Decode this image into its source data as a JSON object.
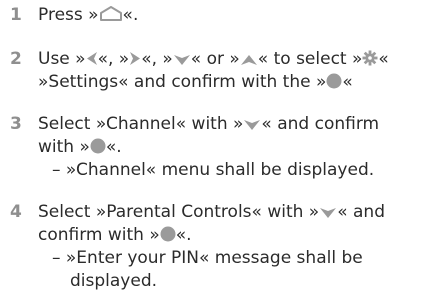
{
  "steps": [
    {
      "number": "1",
      "lines": [
        {
          "pre": "Press »",
          "icon": "home-icon",
          "post": "«."
        }
      ]
    },
    {
      "number": "2",
      "line1": {
        "a": "Use »",
        "b": "«, »",
        "c": "«, »",
        "d": "« or »",
        "e": "« to select »",
        "f": "«"
      },
      "line2": {
        "pre": "»Settings« and confirm with the »",
        "post": "«"
      }
    },
    {
      "number": "3",
      "line1": {
        "pre": "Select »Channel« with »",
        "post": "« and confirm"
      },
      "line2": {
        "pre": "with »",
        "post": "«."
      },
      "note": "– »Channel« menu shall be displayed."
    },
    {
      "number": "4",
      "line1": {
        "pre": "Select »Parental Controls« with »",
        "post": "« and"
      },
      "line2": {
        "pre": "confirm with »",
        "post": "«."
      },
      "note_line1": "– »Enter your PIN« message shall be",
      "note_line2": "displayed."
    }
  ],
  "colors": {
    "icon": "#9a9a9a",
    "text": "#2b2b2b",
    "number": "#8f8f8f"
  },
  "icons": [
    "home-icon",
    "left-arrow-icon",
    "right-arrow-icon",
    "down-arrow-icon",
    "up-arrow-icon",
    "gear-icon",
    "ok-button-icon"
  ]
}
